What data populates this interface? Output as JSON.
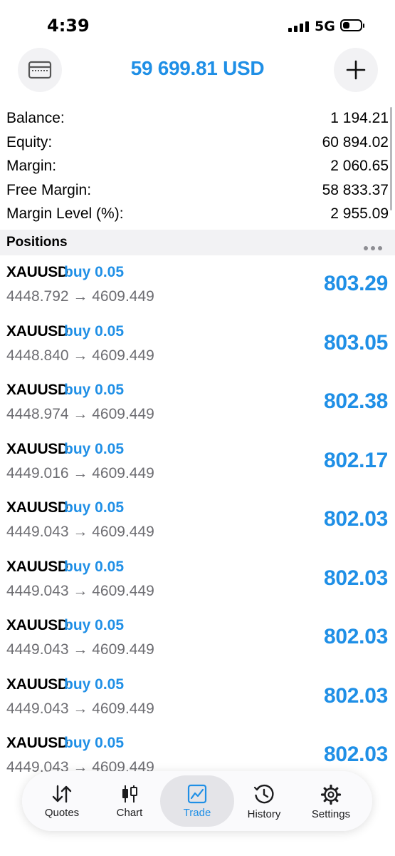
{
  "status_bar": {
    "time": "4:39",
    "network": "5G"
  },
  "header": {
    "balance_title": "59 699.81 USD"
  },
  "account": [
    {
      "label": "Balance:",
      "value": "1 194.21"
    },
    {
      "label": "Equity:",
      "value": "60 894.02"
    },
    {
      "label": "Margin:",
      "value": "2 060.65"
    },
    {
      "label": "Free Margin:",
      "value": "58 833.37"
    },
    {
      "label": "Margin Level (%):",
      "value": "2 955.09"
    }
  ],
  "positions_section": {
    "title": "Positions"
  },
  "positions": [
    {
      "symbol": "XAUUSD",
      "type": "buy 0.05",
      "prices": "4448.792 → 4609.449",
      "profit": "803.29"
    },
    {
      "symbol": "XAUUSD",
      "type": "buy 0.05",
      "prices": "4448.840 → 4609.449",
      "profit": "803.05"
    },
    {
      "symbol": "XAUUSD",
      "type": "buy 0.05",
      "prices": "4448.974 → 4609.449",
      "profit": "802.38"
    },
    {
      "symbol": "XAUUSD",
      "type": "buy 0.05",
      "prices": "4449.016 → 4609.449",
      "profit": "802.17"
    },
    {
      "symbol": "XAUUSD",
      "type": "buy 0.05",
      "prices": "4449.043 → 4609.449",
      "profit": "802.03"
    },
    {
      "symbol": "XAUUSD",
      "type": "buy 0.05",
      "prices": "4449.043 → 4609.449",
      "profit": "802.03"
    },
    {
      "symbol": "XAUUSD",
      "type": "buy 0.05",
      "prices": "4449.043 → 4609.449",
      "profit": "802.03"
    },
    {
      "symbol": "XAUUSD",
      "type": "buy 0.05",
      "prices": "4449.043 → 4609.449",
      "profit": "802.03"
    },
    {
      "symbol": "XAUUSD",
      "type": "buy 0.05",
      "prices": "4449.043 → 4609.449",
      "profit": "802.03"
    }
  ],
  "tabs": [
    {
      "label": "Quotes",
      "icon": "quotes-arrows-icon"
    },
    {
      "label": "Chart",
      "icon": "candlestick-icon"
    },
    {
      "label": "Trade",
      "icon": "trade-chart-icon",
      "active": true
    },
    {
      "label": "History",
      "icon": "history-clock-icon"
    },
    {
      "label": "Settings",
      "icon": "gear-icon"
    }
  ],
  "colors": {
    "accent": "#1f8fe6",
    "muted_text": "#6d6d72",
    "section_bg": "#f2f2f4"
  }
}
